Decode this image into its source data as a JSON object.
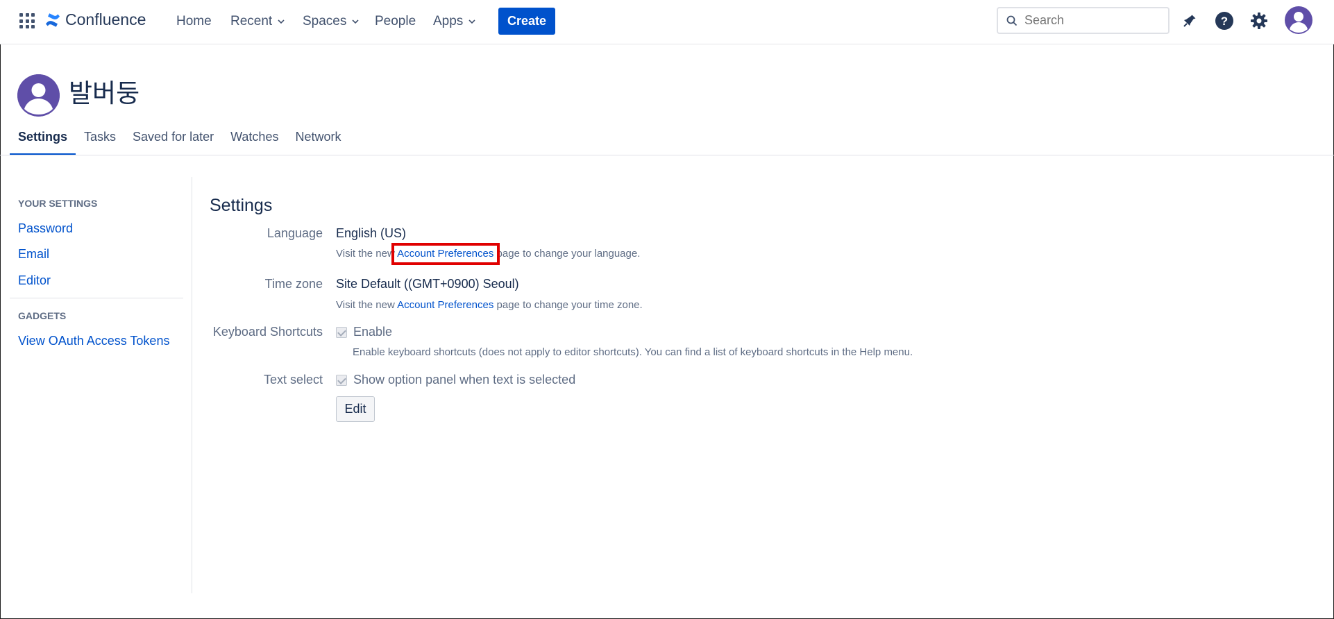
{
  "header": {
    "app_name": "Confluence",
    "nav": [
      {
        "label": "Home"
      },
      {
        "label": "Recent"
      },
      {
        "label": "Spaces"
      },
      {
        "label": "People"
      },
      {
        "label": "Apps"
      }
    ],
    "create_label": "Create",
    "search_placeholder": "Search",
    "icons": [
      "apps-grid-icon",
      "notifications-icon",
      "help-icon",
      "settings-icon",
      "avatar"
    ],
    "brand_color": "#0052cc"
  },
  "profile": {
    "name": "발버둥",
    "tabs": [
      "Settings",
      "Tasks",
      "Saved for later",
      "Watches",
      "Network"
    ],
    "active_tab": "Settings"
  },
  "sidebar": {
    "your_settings_heading": "YOUR SETTINGS",
    "your_settings_links": [
      "Password",
      "Email",
      "Editor"
    ],
    "gadgets_heading": "GADGETS",
    "gadgets_links": [
      "View OAuth Access Tokens"
    ]
  },
  "settings": {
    "title": "Settings",
    "language": {
      "label": "Language",
      "value": "English (US)",
      "desc_prefix": "Visit the new ",
      "link": "Account Preferences",
      "desc_suffix": " page to change your language."
    },
    "timezone": {
      "label": "Time zone",
      "value": "Site Default ((GMT+0900) Seoul)",
      "desc_prefix": "Visit the new ",
      "link": "Account Preferences",
      "desc_suffix": " page to change your time zone."
    },
    "keyboard": {
      "label": "Keyboard Shortcuts",
      "checkbox_label": "Enable",
      "checked": true,
      "desc": "Enable keyboard shortcuts (does not apply to editor shortcuts). You can find a list of keyboard shortcuts in the Help menu."
    },
    "text_select": {
      "label": "Text select",
      "checkbox_label": "Show option panel when text is selected",
      "checked": true
    },
    "edit_label": "Edit"
  }
}
